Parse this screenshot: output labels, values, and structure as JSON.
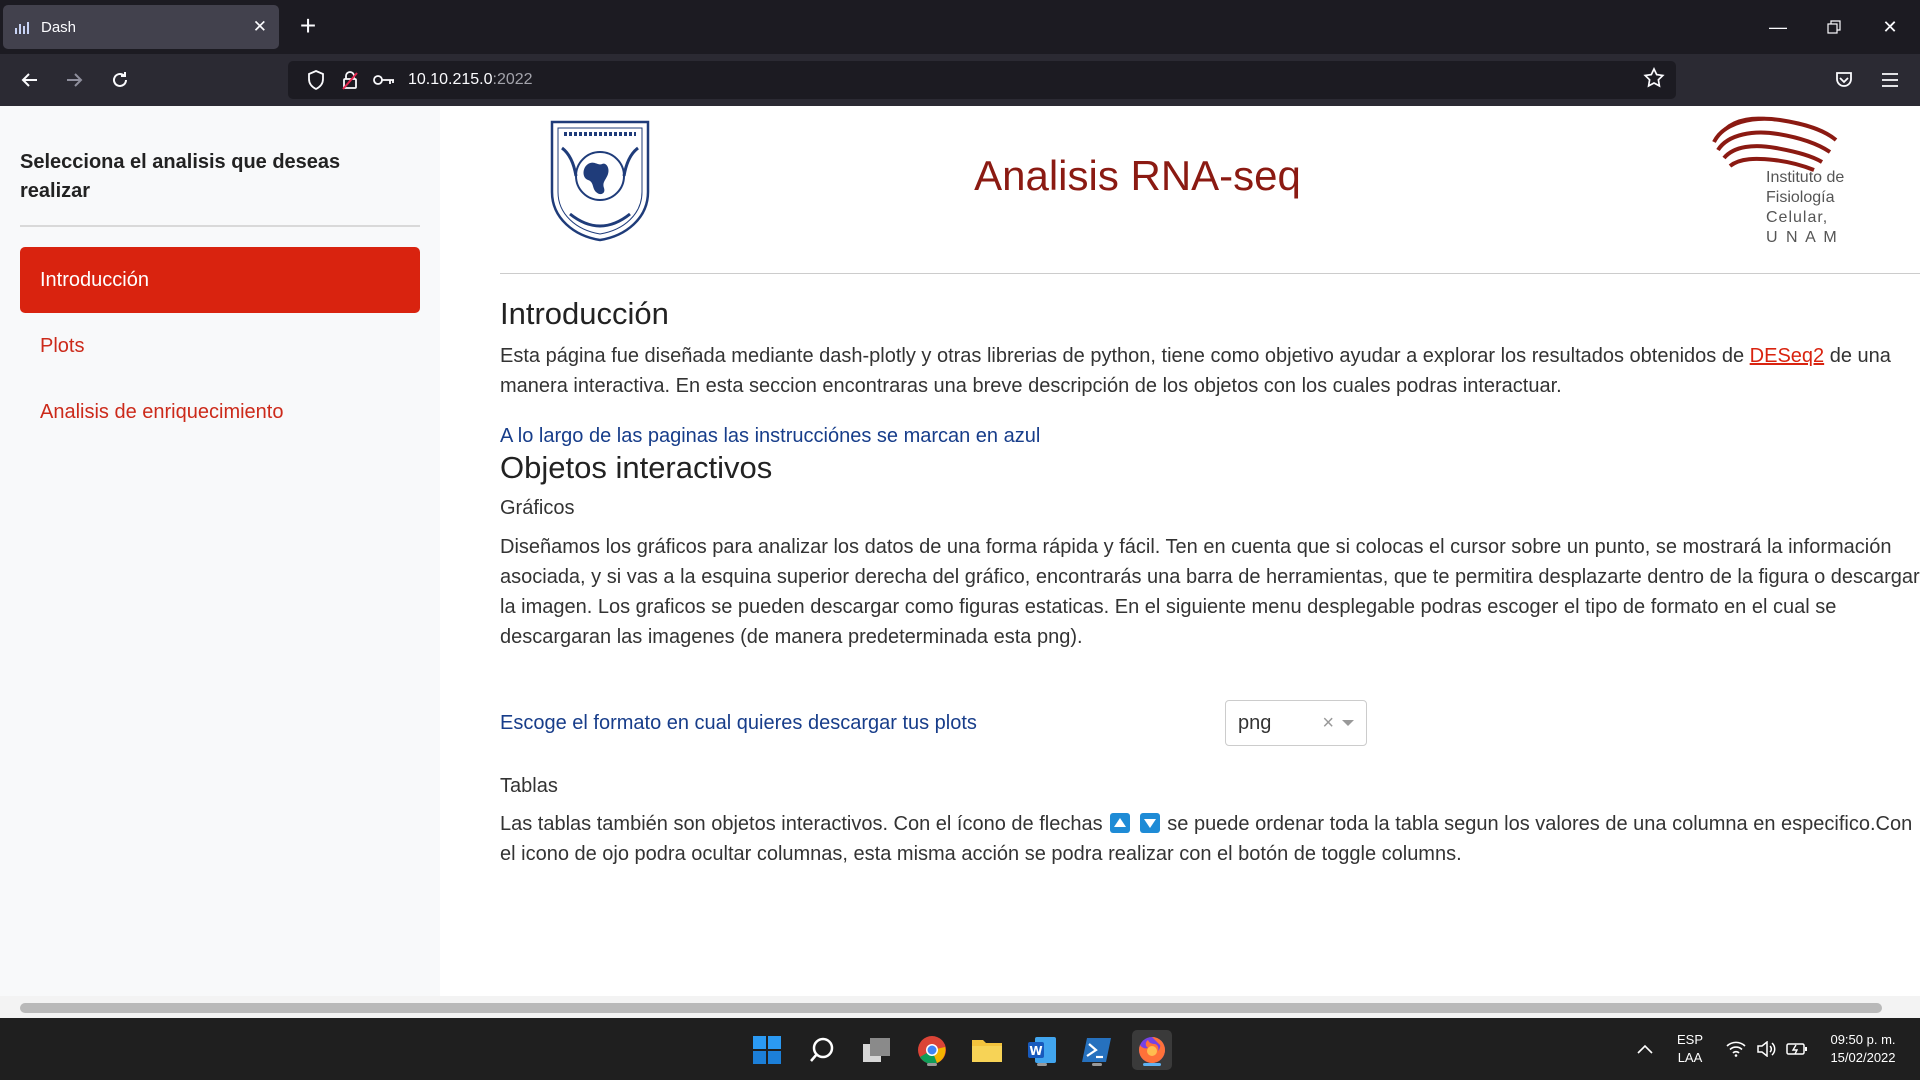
{
  "browser": {
    "tab_title": "Dash",
    "url_host": "10.10.215.0",
    "url_port": ":2022"
  },
  "sidebar": {
    "title": "Selecciona el analisis que deseas realizar",
    "items": [
      {
        "label": "Introducción",
        "active": true
      },
      {
        "label": "Plots",
        "active": false
      },
      {
        "label": "Analisis de enriquecimiento",
        "active": false
      }
    ]
  },
  "header": {
    "title": "Analisis RNA-seq",
    "ifc_logo_lines": [
      "Instituto de",
      "Fisiología",
      "Celular,",
      "U N A M"
    ]
  },
  "intro": {
    "heading": "Introducción",
    "para_before_link": "Esta página fue diseñada mediante dash-plotly y otras librerias de python, tiene como objetivo ayudar a explorar los resultados obtenidos de ",
    "link": "DESeq2",
    "para_after_link": " de una manera interactiva. En esta seccion encontraras una breve descripción de los objetos con los cuales podras interactuar.",
    "instruction_note": "A lo largo de las paginas las instrucciónes se marcan en azul"
  },
  "objects": {
    "heading": "Objetos interactivos",
    "graphs_heading": "Gráficos",
    "graphs_text": "Diseñamos los gráficos para analizar los datos de una forma rápida y fácil. Ten en cuenta que si colocas el cursor sobre un punto, se mostrará la información asociada, y si vas a la esquina superior derecha del gráfico, encontrarás una barra de herramientas, que te permitira desplazarte dentro de la figura o descargar la imagen. Los graficos se pueden descargar como figuras estaticas. En el siguiente menu desplegable podras escoger el tipo de formato en el cual se descargaran las imagenes (de manera predeterminada esta png).",
    "format_label": "Escoge el formato en cual quieres descargar tus plots",
    "format_value": "png",
    "tables_heading": "Tablas",
    "tables_text_before": "Las tablas también son objetos interactivos. Con el ícono de flechas ",
    "tables_text_after": " se puede ordenar toda la tabla segun los valores de una columna en especifico.Con el icono de ojo podra ocultar columnas, esta misma acción se podra realizar con el botón de toggle columns."
  },
  "taskbar": {
    "lang_top": "ESP",
    "lang_bottom": "LAA",
    "time": "09:50 p. m.",
    "date": "15/02/2022"
  },
  "colors": {
    "accent": "#d9230f",
    "title": "#8b1a12",
    "instruction_blue": "#173d8a",
    "sort_icon": "#1e8bd6"
  }
}
